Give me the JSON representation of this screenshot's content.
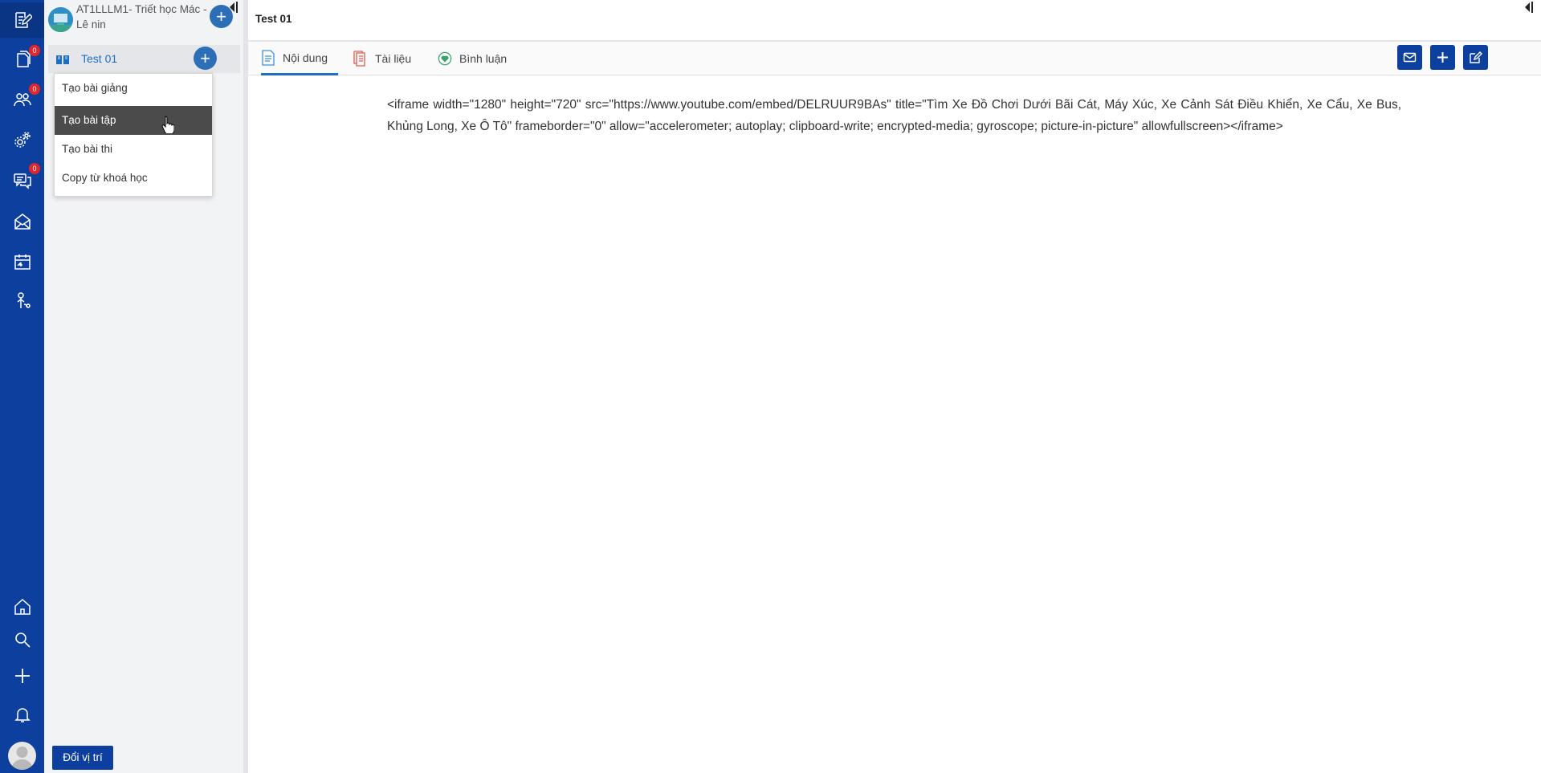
{
  "rail": {
    "items": [
      {
        "icon": "edit-note-icon",
        "badge": ""
      },
      {
        "icon": "document-icon",
        "badge": "0"
      },
      {
        "icon": "users-icon",
        "badge": "0"
      },
      {
        "icon": "settings-gears-icon",
        "badge": ""
      },
      {
        "icon": "chat-icon",
        "badge": "0"
      },
      {
        "icon": "mail-open-icon",
        "badge": ""
      },
      {
        "icon": "calendar-icon",
        "badge": ""
      },
      {
        "icon": "hand-stats-icon",
        "badge": ""
      }
    ],
    "bottom_items": [
      "home-icon",
      "search-icon",
      "plus-icon",
      "bell-icon"
    ]
  },
  "course": {
    "title": "AT1LLLM1- Triết học Mác - Lê nin",
    "add_symbol": "+"
  },
  "lesson": {
    "label": "Test 01",
    "add_symbol": "+"
  },
  "dropdown": {
    "items": [
      "Tạo bài giảng",
      "Tạo bài tập",
      "Tạo bài thi",
      "Copy từ khoá học"
    ],
    "hovered_index": 1
  },
  "sidebar_footer": {
    "move_button": "Đổi vị trí"
  },
  "main": {
    "title": "Test 01",
    "tabs": [
      {
        "label": "Nội dung",
        "icon": "document-icon",
        "active": true
      },
      {
        "label": "Tài liệu",
        "icon": "files-icon",
        "active": false
      },
      {
        "label": "Bình luận",
        "icon": "heart-chat-icon",
        "active": false
      }
    ],
    "toolbar": [
      "mail-icon",
      "plus-icon",
      "edit-icon"
    ],
    "content_text": "<iframe width=\"1280\" height=\"720\" src=\"https://www.youtube.com/embed/DELRUUR9BAs\" title=\"Tìm Xe Đồ Chơi Dưới Bãi Cát, Máy Xúc, Xe Cảnh Sát Điều Khiển, Xe Cẩu, Xe Bus, Khủng Long, Xe Ô Tô\" frameborder=\"0\" allow=\"accelerometer; autoplay; clipboard-write; encrypted-media; gyroscope; picture-in-picture\" allowfullscreen></iframe>"
  },
  "colors": {
    "rail": "#0c3f9e",
    "accent": "#1d6fc1",
    "badge": "#e3262b",
    "menu_hover": "#4b4b4b"
  }
}
